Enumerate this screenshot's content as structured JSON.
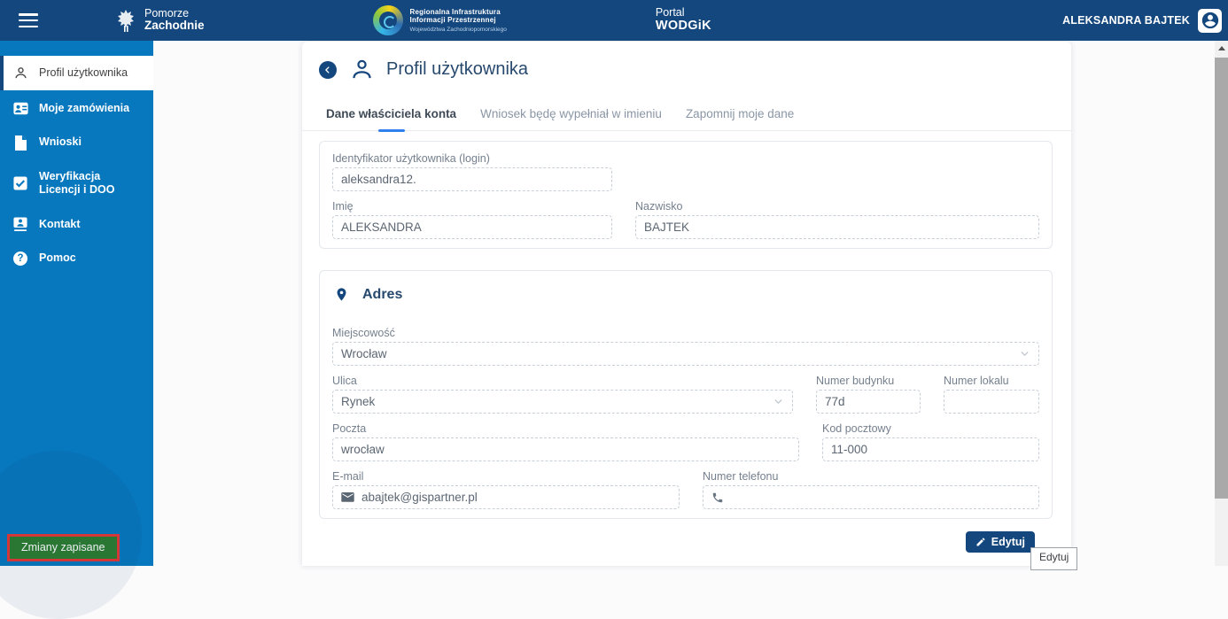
{
  "colors": {
    "header_bg": "#14477D",
    "sidebar_bg": "#0878BE",
    "accent_navy": "#14477D",
    "tab_underline": "#2F80ED",
    "title_text": "#27496E",
    "label_gray": "#75808E",
    "value_gray": "#5C6673",
    "toast_bg": "#2E7D32",
    "toast_highlight_border": "#E53935"
  },
  "header": {
    "hamburger_icon": "hamburger-menu-icon",
    "brand_pomorze": {
      "line1": "Pomorze",
      "line2": "Zachodnie",
      "icon": "pomorze-zachodnie-griffin-icon"
    },
    "brand_riip": {
      "line1": "Regionalna Infrastruktura",
      "line2": "Informacji Przestrzennej",
      "line3": "Województwa Zachodniopomorskiego",
      "icon": "riip-circle-logo"
    },
    "brand_portal": {
      "line1": "Portal",
      "line2": "WODGiK"
    },
    "user_name": "ALEKSANDRA BAJTEK",
    "avatar_icon": "account-circle-icon"
  },
  "sidebar": {
    "items": [
      {
        "label": "Profil użytkownika",
        "icon": "user-icon",
        "active": true
      },
      {
        "label": "Moje zamówienia",
        "icon": "orders-badge-icon",
        "active": false
      },
      {
        "label": "Wnioski",
        "icon": "document-icon",
        "active": false
      },
      {
        "label": "Weryfikacja Licencji i DOO",
        "icon": "checkbox-icon",
        "active": false
      },
      {
        "label": "Kontakt",
        "icon": "contact-card-icon",
        "active": false
      },
      {
        "label": "Pomoc",
        "icon": "help-question-icon",
        "active": false
      }
    ],
    "toast": {
      "text": "Zmiany zapisane"
    }
  },
  "main": {
    "back_icon": "back-chevron-icon",
    "title_icon": "user-outline-icon",
    "title": "Profil użytkownika",
    "tabs": [
      {
        "label": "Dane właściciela konta",
        "active": true
      },
      {
        "label": "Wniosek będę wypełniał w imieniu",
        "active": false
      },
      {
        "label": "Zapomnij moje dane",
        "active": false
      }
    ],
    "account_card": {
      "login": {
        "label": "Identyfikator użytkownika (login)",
        "value": "aleksandra12."
      },
      "first_name": {
        "label": "Imię",
        "value": "ALEKSANDRA"
      },
      "last_name": {
        "label": "Nazwisko",
        "value": "BAJTEK"
      }
    },
    "address_card": {
      "title": "Adres",
      "title_icon": "location-pin-icon",
      "city": {
        "label": "Miejscowość",
        "value": "Wrocław"
      },
      "street": {
        "label": "Ulica",
        "value": "Rynek"
      },
      "building": {
        "label": "Numer budynku",
        "value": "77d"
      },
      "apartment": {
        "label": "Numer lokalu",
        "value": ""
      },
      "post": {
        "label": "Poczta",
        "value": "wrocław"
      },
      "postal_code": {
        "label": "Kod pocztowy",
        "value": "11-000"
      },
      "email": {
        "label": "E-mail",
        "value": "abajtek@gispartner.pl",
        "icon": "email-icon"
      },
      "phone": {
        "label": "Numer telefonu",
        "value": "",
        "icon": "phone-icon"
      }
    },
    "edit_button": {
      "label": "Edytuj",
      "icon": "pencil-icon"
    },
    "tooltip": {
      "text": "Edytuj"
    }
  }
}
